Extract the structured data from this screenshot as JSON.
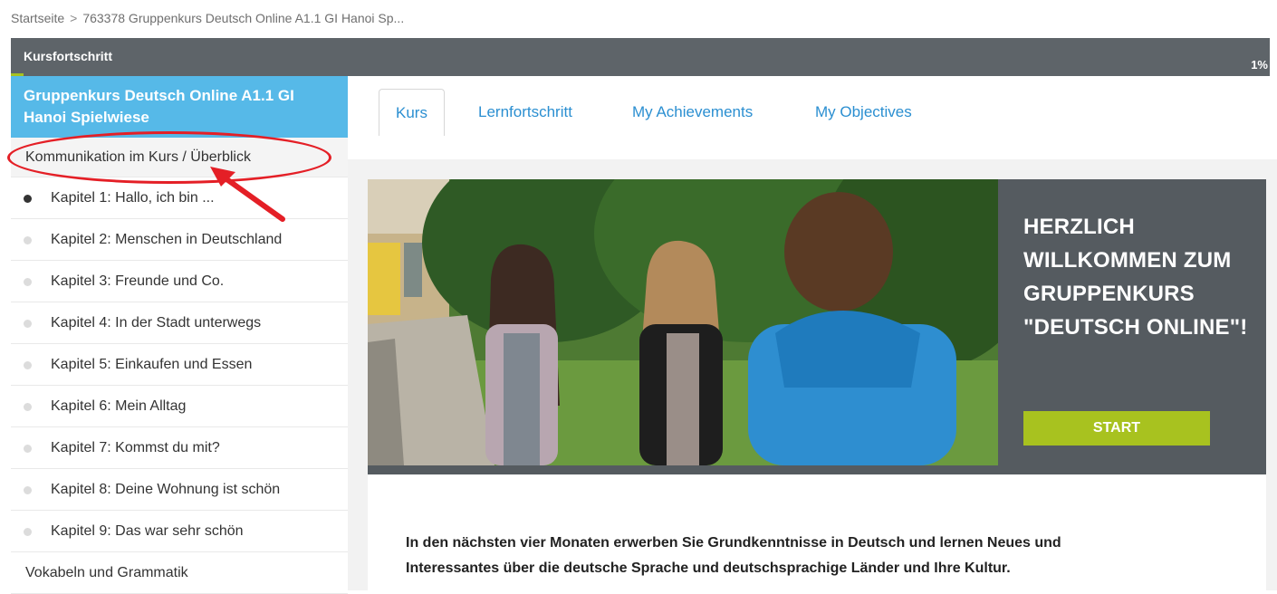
{
  "breadcrumb": {
    "home": "Startseite",
    "separator": ">",
    "current": "763378 Gruppenkurs Deutsch Online A1.1 GI Hanoi Sp..."
  },
  "progress": {
    "label": "Kursfortschritt",
    "percent_text": "1%",
    "value": 0.01,
    "fill_color": "#a8c21f"
  },
  "sidebar": {
    "course_title_line1": "Gruppenkurs Deutsch Online A1.1 GI",
    "course_title_line2": "Hanoi Spielwiese",
    "overview": "Kommunikation im Kurs / Überblick",
    "chapters": [
      "Kapitel 1: Hallo, ich bin ...",
      "Kapitel 2: Menschen in Deutschland",
      "Kapitel 3: Freunde und Co.",
      "Kapitel 4: In der Stadt unterwegs",
      "Kapitel 5: Einkaufen und Essen",
      "Kapitel 6: Mein Alltag",
      "Kapitel 7: Kommst du mit?",
      "Kapitel 8: Deine Wohnung ist schön",
      "Kapitel 9: Das war sehr schön"
    ],
    "vocab": "Vokabeln und Grammatik"
  },
  "tabs": [
    "Kurs",
    "Lernfortschritt",
    "My Achievements",
    "My Objectives"
  ],
  "hero": {
    "welcome_line1": "HERZLICH",
    "welcome_line2": "WILLKOMMEN ZUM",
    "welcome_line3": "GRUPPENKURS",
    "welcome_line4": "\"DEUTSCH ONLINE\"!",
    "start_label": "START"
  },
  "intro": {
    "line1": "In den nächsten vier Monaten erwerben Sie Grundkenntnisse in Deutsch und lernen Neues und",
    "line2": "Interessantes über die deutsche Sprache und deutschsprachige Länder und Ihre Kultur."
  },
  "colors": {
    "accent_blue": "#56b9e8",
    "link_blue": "#2b8fd1",
    "dark_gray": "#555b60",
    "green": "#a8c21f",
    "annotation_red": "#e41f26"
  }
}
